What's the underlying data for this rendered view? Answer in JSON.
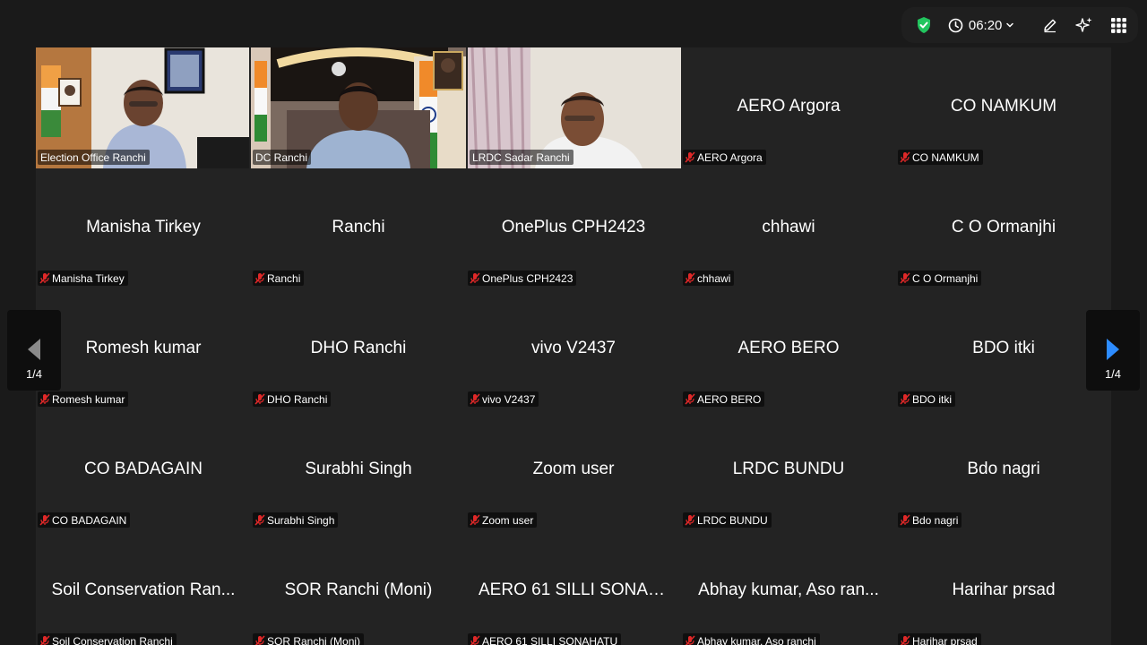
{
  "topbar": {
    "timer": "06:20",
    "colors": {
      "shield": "#22c55e",
      "bg": "#1f1f1f"
    },
    "icons": {
      "shield": "shield-check-icon",
      "clock": "clock-icon",
      "edit": "pencil-icon",
      "ai": "sparkle-icon",
      "apps": "grid-icon"
    }
  },
  "pager": {
    "left_label": "1/4",
    "right_label": "1/4",
    "arrow_color": "#2d8cff"
  },
  "video_tiles": [
    {
      "nameplate": "Election Office Ranchi"
    },
    {
      "nameplate": "DC Ranchi"
    },
    {
      "nameplate": "LRDC Sadar Ranchi"
    }
  ],
  "participants": [
    {
      "name": "AERO Argora",
      "label": "AERO Argora"
    },
    {
      "name": "CO NAMKUM",
      "label": "CO NAMKUM"
    },
    {
      "name": "Manisha Tirkey",
      "label": "Manisha Tirkey"
    },
    {
      "name": "Ranchi",
      "label": "Ranchi"
    },
    {
      "name": "OnePlus CPH2423",
      "label": "OnePlus CPH2423"
    },
    {
      "name": "chhawi",
      "label": "chhawi"
    },
    {
      "name": "C O Ormanjhi",
      "label": "C O Ormanjhi"
    },
    {
      "name": "Romesh kumar",
      "label": "Romesh kumar"
    },
    {
      "name": "DHO Ranchi",
      "label": "DHO Ranchi"
    },
    {
      "name": "vivo V2437",
      "label": "vivo V2437"
    },
    {
      "name": "AERO BERO",
      "label": "AERO BERO"
    },
    {
      "name": "BDO itki",
      "label": "BDO itki"
    },
    {
      "name": "CO BADAGAIN",
      "label": "CO BADAGAIN"
    },
    {
      "name": "Surabhi Singh",
      "label": "Surabhi Singh"
    },
    {
      "name": "Zoom user",
      "label": "Zoom user"
    },
    {
      "name": "LRDC BUNDU",
      "label": "LRDC BUNDU"
    },
    {
      "name": "Bdo nagri",
      "label": "Bdo nagri"
    },
    {
      "name": "Soil Conservation Ran...",
      "label": "Soil Conservation Ranchi"
    },
    {
      "name": "SOR Ranchi (Moni)",
      "label": "SOR Ranchi (Moni)"
    },
    {
      "name": "AERO 61 SILLI SONAH...",
      "label": "AERO 61 SILLI SONAHATU"
    },
    {
      "name": "Abhay kumar, Aso ran...",
      "label": "Abhay kumar, Aso ranchi"
    },
    {
      "name": "Harihar prsad",
      "label": "Harihar prsad"
    }
  ],
  "mute_icon_color": "#e02828"
}
